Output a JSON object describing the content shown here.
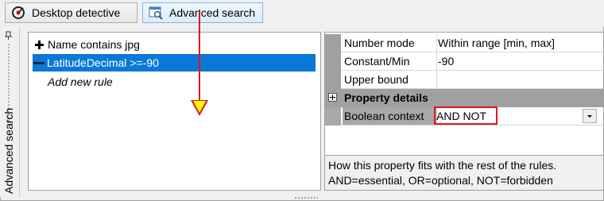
{
  "toolbar": {
    "desktop_label": "Desktop detective",
    "advanced_label": "Advanced search"
  },
  "sidebar": {
    "tab_label": "Advanced search"
  },
  "rules": {
    "items": [
      {
        "label": "Name contains jpg",
        "icon": "plus-icon"
      },
      {
        "label": "LatitudeDecimal >=-90",
        "icon": "minus-icon",
        "selected": true
      }
    ],
    "add_label": "Add new rule"
  },
  "properties": {
    "rows": [
      {
        "name": "Number mode",
        "value": "Within range [min, max]"
      },
      {
        "name": "Constant/Min",
        "value": "-90"
      },
      {
        "name": "Upper bound",
        "value": ""
      }
    ],
    "category": "Property details",
    "boolean_context": {
      "name": "Boolean context",
      "value": "AND NOT"
    },
    "help": [
      "How this property fits with the rest of the rules.",
      "AND=essential, OR=optional, NOT=forbidden"
    ]
  },
  "colors": {
    "selection": "#0b78d7",
    "highlight": "#e0161b",
    "arrow_fill": "#ffff00"
  }
}
